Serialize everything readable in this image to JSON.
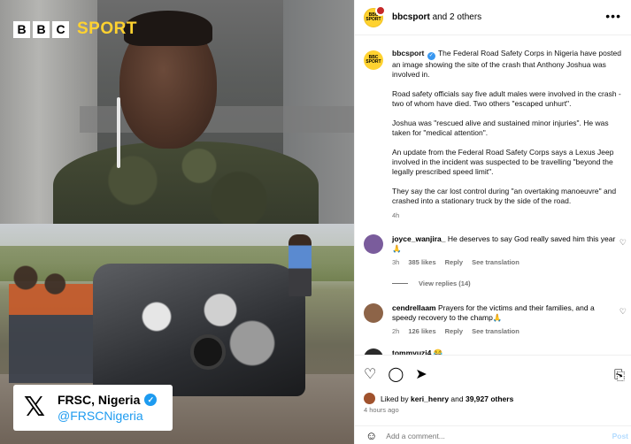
{
  "media": {
    "bbc_letters": [
      "B",
      "B",
      "C"
    ],
    "bbc_sport": "SPORT",
    "frsc_name": "FRSC, Nigeria",
    "frsc_handle": "@FRSCNigeria",
    "x_logo": "𝕏"
  },
  "header": {
    "avatar_text": "BBC SPORT",
    "account": "bbcsport",
    "and_others": "and 2 others",
    "more": "•••"
  },
  "caption": {
    "username": "bbcsport",
    "verified": "✓",
    "paragraphs": [
      "The Federal Road Safety Corps in Nigeria have posted an image showing the site of the crash that Anthony Joshua was involved in.",
      "Road safety officials say five adult males were involved in the crash - two of whom have died. Two others \"escaped unhurt\".",
      "Joshua was \"rescued alive and sustained minor injuries\". He was taken for \"medical attention\".",
      "An update from the Federal Road Safety Corps says a Lexus Jeep involved in the incident was suspected to be travelling \"beyond the legally prescribed speed limit\".",
      "They say the car lost control during \"an overtaking manoeuvre\" and crashed into a stationary truck by the side of the road."
    ],
    "time": "4h"
  },
  "comments": [
    {
      "username": "joyce_wanjira_",
      "text": "He deserves to say God really saved him this year 🙏",
      "time": "3h",
      "likes": "385 likes",
      "reply": "Reply",
      "translate": "See translation",
      "avatar_color": "#7a5c9c"
    },
    {
      "username": "cendrellaam",
      "text": "Prayers for the victims and their families, and a speedy recovery to the champ🙏",
      "time": "2h",
      "likes": "126 likes",
      "reply": "Reply",
      "translate": "See translation",
      "avatar_color": "#8d6448"
    },
    {
      "username": "tommyuzi4",
      "text": "😂",
      "avatar_color": "#2b2b2b"
    }
  ],
  "view_replies": "View replies (14)",
  "actions": {
    "like_icon": "♡",
    "comment_icon": "◯",
    "share_icon": "➤",
    "bookmark_icon": "⎘",
    "liked_by": "Liked by",
    "liked_user": "keri_henry",
    "and": "and",
    "others": "39,927 others",
    "post_time": "4 hours ago",
    "smile_icon": "☺",
    "comment_placeholder": "Add a comment...",
    "post": "Post"
  }
}
